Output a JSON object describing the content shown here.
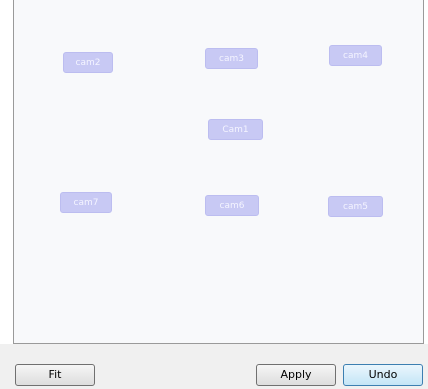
{
  "diagram": {
    "nodes": [
      {
        "id": "cam2",
        "label": "cam2"
      },
      {
        "id": "cam3",
        "label": "cam3"
      },
      {
        "id": "cam4",
        "label": "cam4"
      },
      {
        "id": "cam1",
        "label": "Cam1"
      },
      {
        "id": "cam7",
        "label": "cam7"
      },
      {
        "id": "cam6",
        "label": "cam6"
      },
      {
        "id": "cam5",
        "label": "cam5"
      }
    ]
  },
  "buttons": {
    "fit_label": "Fit",
    "apply_label": "Apply",
    "undo_label": "Undo"
  },
  "colors": {
    "node_fill": "#c8c9f4",
    "node_text": "#f4f4ff",
    "canvas_bg": "#f8f9fb",
    "default_button_border": "#3c7fb1"
  }
}
